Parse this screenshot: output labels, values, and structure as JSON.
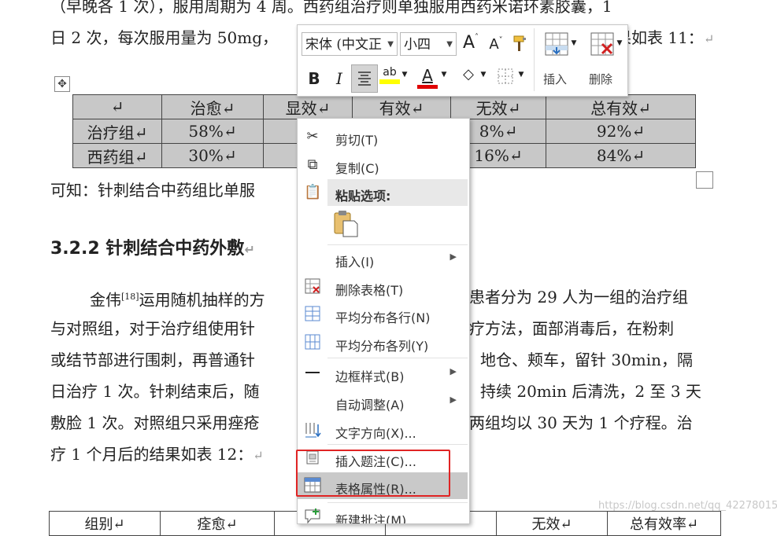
{
  "document": {
    "line1": "（早晚各 1 次），服用周期为 4 周。西药组治疗则单独服用西药米诺环素胶囊，1",
    "line2_left": "日 2 次，每次服用量为 50mg，",
    "line2_right": "果如表 11：",
    "para_mark": "↵",
    "after_table": "可知：针刺结合中药组比单服",
    "heading": "3.2.2 针刺结合中药外敷",
    "p2_line1_a": "金伟",
    "p2_line1_sup": "[18]",
    "p2_line1_b": "运用随机抽样的方",
    "p2_line1_c": "患者分为 29 人为一组的治疗组",
    "p2_line2_a": "与对照组，对于治疗组使用针",
    "p2_line2_c": "疗方法，面部消毒后，在粉刺",
    "p2_line3_a": "或结节部进行围刺，再普通针",
    "p2_line3_c": "地仓、颊车，留针 30min，隔",
    "p2_line4_a": "日治疗 1 次。针刺结束后，随",
    "p2_line4_c": "持续 20min 后清洗，2 至 3 天",
    "p2_line5_a": "敷脸 1 次。对照组只采用痤疮",
    "p2_line5_c": "两组均以 30 天为 1 个疗程。治",
    "p2_line6_a": "疗 1 个月后的结果如表 12：",
    "table_headers": [
      "↵",
      "治愈↵",
      "显效↵",
      "有效↵",
      "无效↵",
      "总有效↵"
    ],
    "table_rows": [
      [
        "治疗组↵",
        "58%↵",
        "",
        "",
        "8%↵",
        "92%↵"
      ],
      [
        "西药组↵",
        "30%↵",
        "",
        "",
        "16%↵",
        "84%↵"
      ]
    ],
    "bottom_table": [
      "组别↵",
      "痊愈↵",
      "",
      "",
      "无效↵",
      "总有效率↵"
    ]
  },
  "mini_toolbar": {
    "font_name": "宋体 (中文正",
    "font_size": "小四",
    "insert_label": "插入",
    "delete_label": "删除"
  },
  "context_menu": {
    "items": [
      {
        "label": "剪切(T)",
        "icon": "scissors-icon"
      },
      {
        "label": "复制(C)",
        "icon": "copy-icon"
      },
      {
        "label": "粘贴选项:",
        "icon": "paste-icon"
      },
      {
        "label": "插入(I)",
        "icon": "",
        "submenu": true
      },
      {
        "label": "删除表格(T)",
        "icon": "delete-table-icon"
      },
      {
        "label": "平均分布各行(N)",
        "icon": "distribute-rows-icon"
      },
      {
        "label": "平均分布各列(Y)",
        "icon": "distribute-columns-icon"
      },
      {
        "label": "边框样式(B)",
        "icon": "border-style-icon",
        "submenu": true
      },
      {
        "label": "自动调整(A)",
        "icon": "",
        "submenu": true
      },
      {
        "label": "文字方向(X)...",
        "icon": "text-direction-icon"
      },
      {
        "label": "插入题注(C)...",
        "icon": "insert-caption-icon"
      },
      {
        "label": "表格属性(R)...",
        "icon": "table-properties-icon"
      },
      {
        "label": "新建批注(M)",
        "icon": "new-comment-icon"
      }
    ]
  },
  "watermark": "https://blog.csdn.net/qq_42278015",
  "colors": {
    "selection_gray": "#c8c8c8",
    "highlight_red": "#e02424",
    "highlighter_yellow": "#ffff00",
    "font_color_red": "#e00000"
  }
}
